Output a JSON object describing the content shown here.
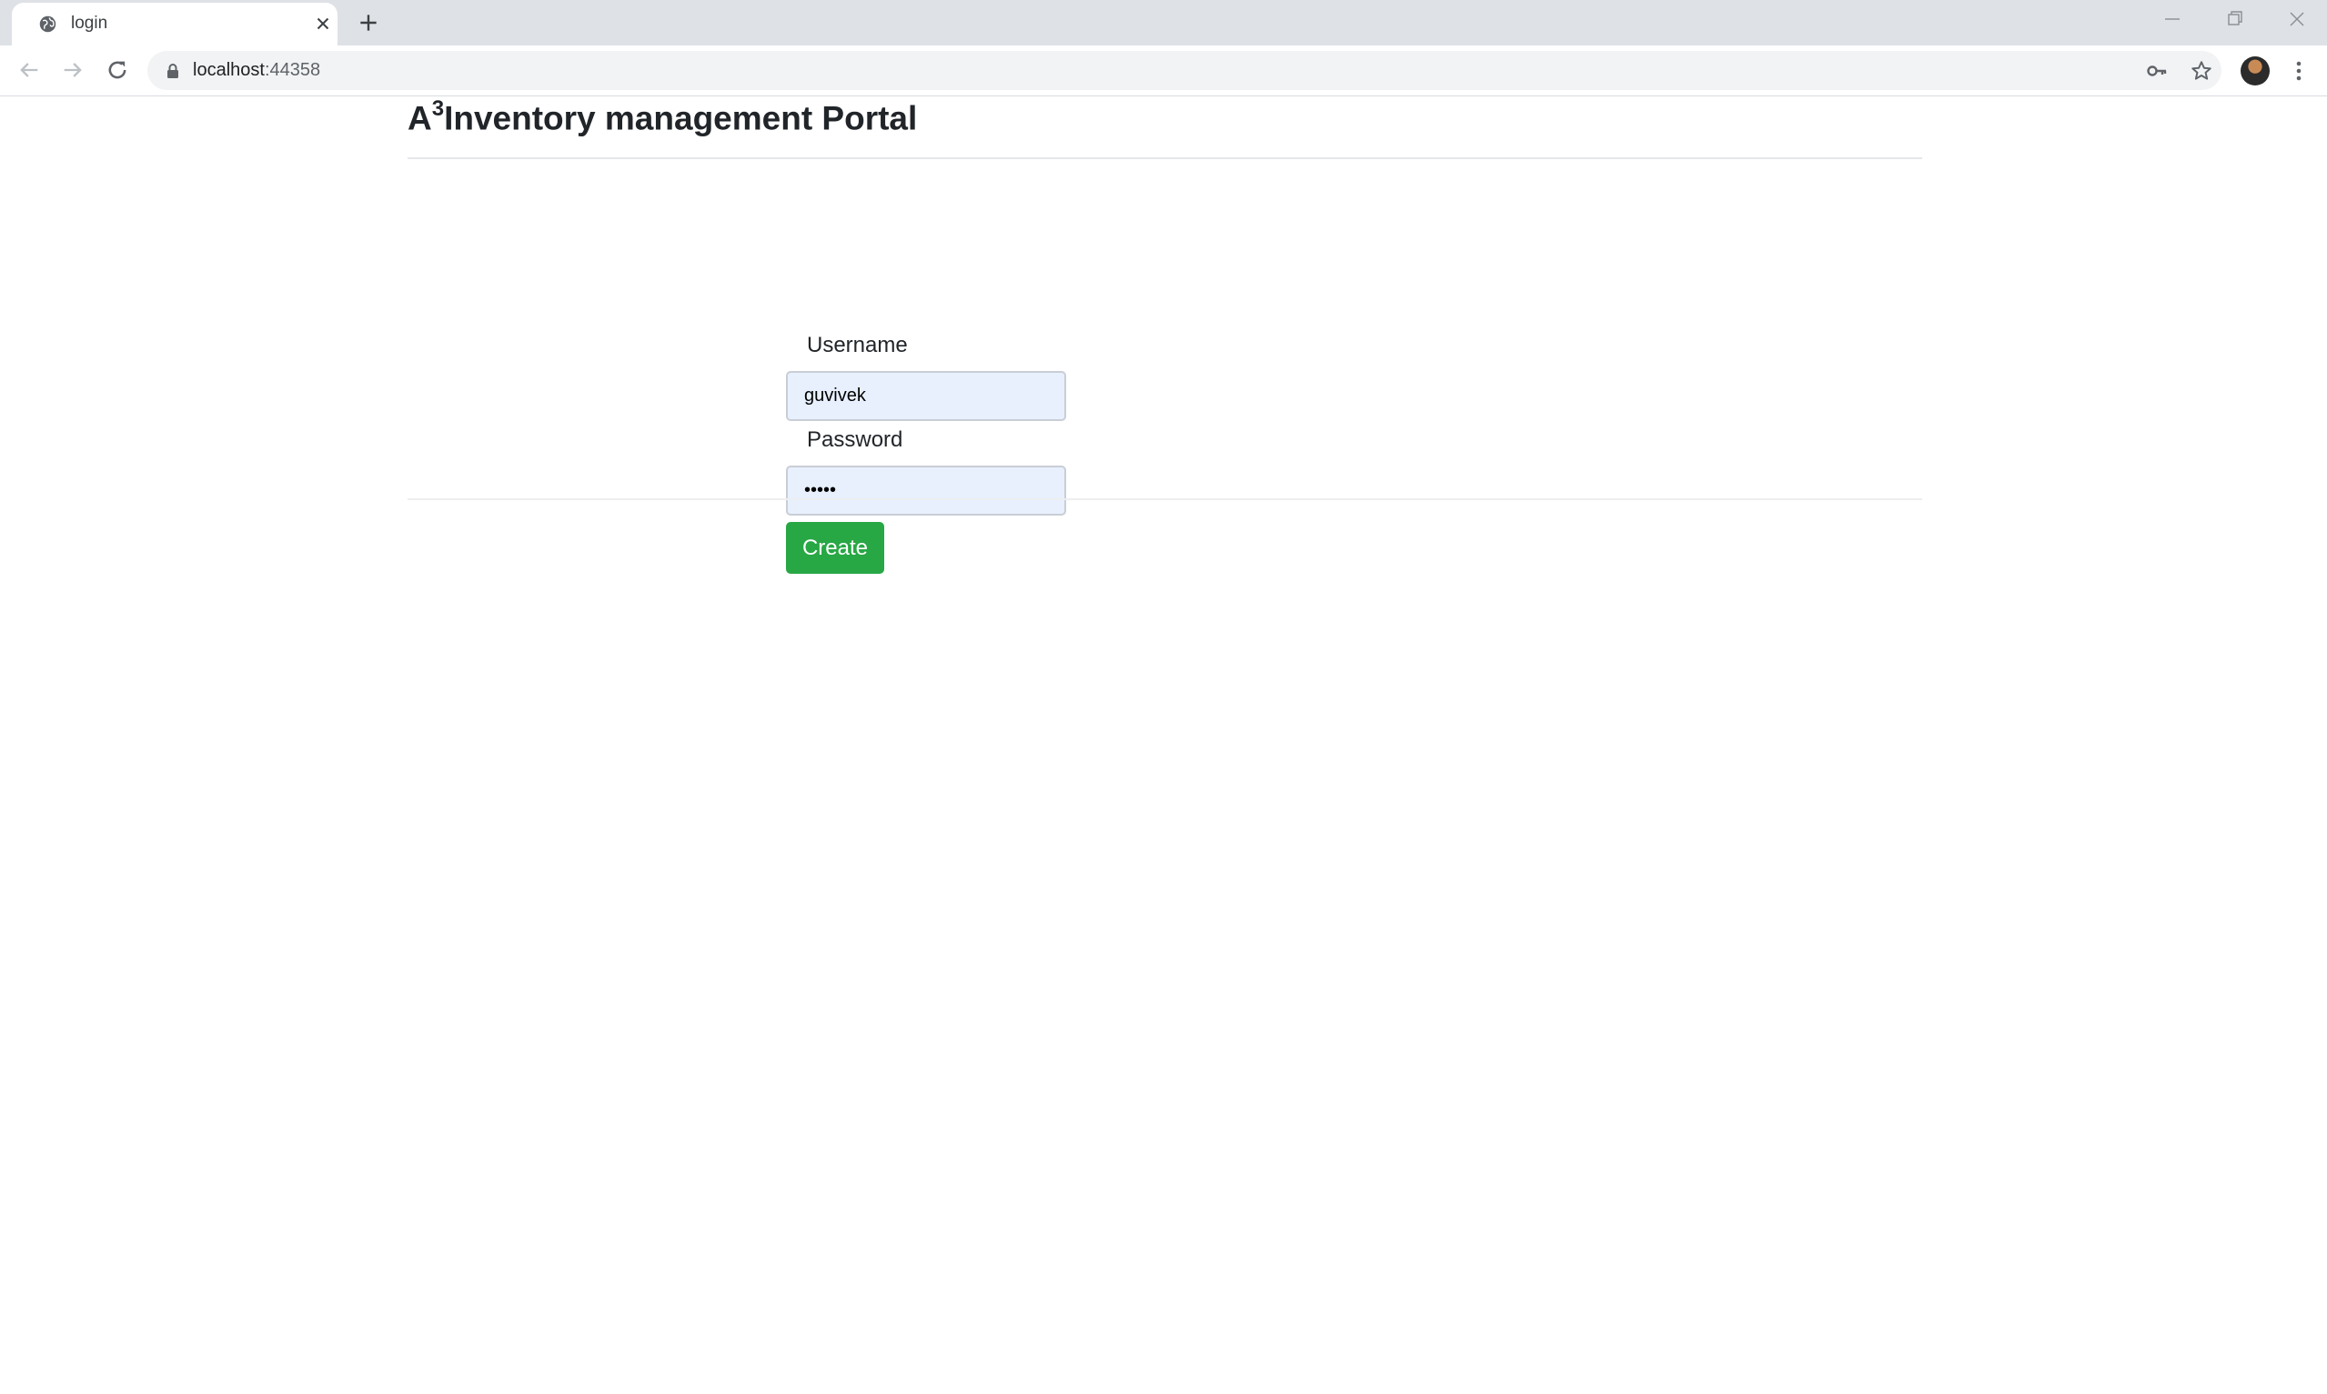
{
  "browser": {
    "tab_title": "login",
    "url_host": "localhost",
    "url_port": ":44358"
  },
  "page": {
    "brand_prefix": "A",
    "brand_superscript": "3",
    "brand_title": "Inventory management Portal",
    "form": {
      "username_label": "Username",
      "username_value": "guvivek",
      "password_label": "Password",
      "password_value": "•••••",
      "submit_label": "Create"
    }
  },
  "colors": {
    "primary_button": "#28a745",
    "autofill_bg": "#e8f0fe"
  }
}
